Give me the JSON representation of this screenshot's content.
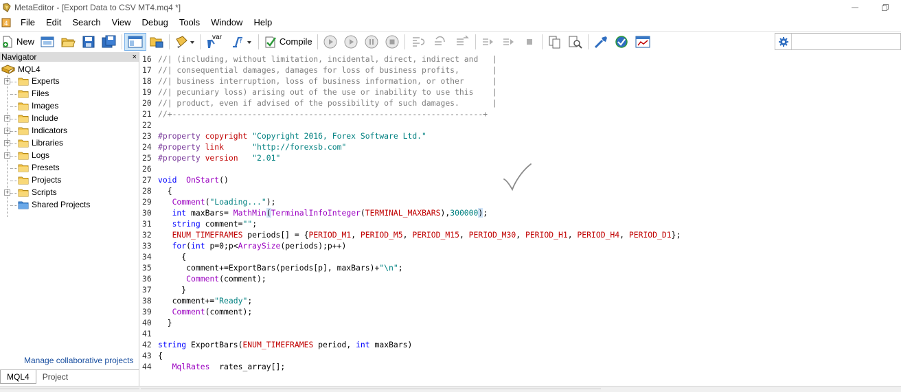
{
  "window": {
    "title": "MetaEditor - [Export Data to CSV MT4.mq4 *]"
  },
  "menu": {
    "items": [
      "File",
      "Edit",
      "Search",
      "View",
      "Debug",
      "Tools",
      "Window",
      "Help"
    ]
  },
  "toolbar": {
    "new_label": "New",
    "var_label": "var",
    "compile_label": "Compile",
    "search_placeholder": ""
  },
  "navigator": {
    "title": "Navigator",
    "close_glyph": "×",
    "root": "MQL4",
    "items": [
      {
        "label": "Experts",
        "expandable": true
      },
      {
        "label": "Files",
        "expandable": false
      },
      {
        "label": "Images",
        "expandable": false
      },
      {
        "label": "Include",
        "expandable": true
      },
      {
        "label": "Indicators",
        "expandable": true
      },
      {
        "label": "Libraries",
        "expandable": true
      },
      {
        "label": "Logs",
        "expandable": true
      },
      {
        "label": "Presets",
        "expandable": false
      },
      {
        "label": "Projects",
        "expandable": false
      },
      {
        "label": "Scripts",
        "expandable": true
      },
      {
        "label": "Shared Projects",
        "expandable": false
      }
    ],
    "manage_link": "Manage collaborative projects",
    "tabs": [
      "MQL4",
      "Project"
    ]
  },
  "editor": {
    "lines": [
      {
        "n": "16",
        "tokens": [
          [
            "comment",
            "//| (including, without limitation, incidental, direct, indirect and   |"
          ]
        ]
      },
      {
        "n": "17",
        "tokens": [
          [
            "comment",
            "//| consequential damages, damages for loss of business profits,       |"
          ]
        ]
      },
      {
        "n": "18",
        "tokens": [
          [
            "comment",
            "//| business interruption, loss of business information, or other      |"
          ]
        ]
      },
      {
        "n": "19",
        "tokens": [
          [
            "comment",
            "//| pecuniary loss) arising out of the use or inability to use this    |"
          ]
        ]
      },
      {
        "n": "20",
        "tokens": [
          [
            "comment",
            "//| product, even if advised of the possibility of such damages.       |"
          ]
        ]
      },
      {
        "n": "21",
        "tokens": [
          [
            "comment",
            "//+------------------------------------------------------------------+"
          ]
        ]
      },
      {
        "n": "22",
        "tokens": []
      },
      {
        "n": "23",
        "tokens": [
          [
            "property",
            "#property "
          ],
          [
            "propname",
            "copyright "
          ],
          [
            "string",
            "\"Copyright 2016, Forex Software Ltd.\""
          ]
        ]
      },
      {
        "n": "24",
        "tokens": [
          [
            "property",
            "#property "
          ],
          [
            "propname",
            "link      "
          ],
          [
            "string",
            "\"http://forexsb.com\""
          ]
        ]
      },
      {
        "n": "25",
        "tokens": [
          [
            "property",
            "#property "
          ],
          [
            "propname",
            "version   "
          ],
          [
            "string",
            "\"2.01\""
          ]
        ]
      },
      {
        "n": "26",
        "tokens": []
      },
      {
        "n": "27",
        "tokens": [
          [
            "keyword",
            "void"
          ],
          [
            "text",
            "  "
          ],
          [
            "func",
            "OnStart"
          ],
          [
            "text",
            "()"
          ]
        ]
      },
      {
        "n": "28",
        "tokens": [
          [
            "text",
            "  {"
          ]
        ]
      },
      {
        "n": "29",
        "tokens": [
          [
            "text",
            "   "
          ],
          [
            "func",
            "Comment"
          ],
          [
            "text",
            "("
          ],
          [
            "string",
            "\"Loading...\""
          ],
          [
            "text",
            ");"
          ]
        ]
      },
      {
        "n": "30",
        "tokens": [
          [
            "text",
            "   "
          ],
          [
            "keyword",
            "int"
          ],
          [
            "text",
            " maxBars= "
          ],
          [
            "func",
            "MathMin"
          ],
          [
            "mark",
            "("
          ],
          [
            "func",
            "TerminalInfoInteger"
          ],
          [
            "text",
            "("
          ],
          [
            "enum",
            "TERMINAL_MAXBARS"
          ],
          [
            "text",
            "),"
          ],
          [
            "string",
            "300000"
          ],
          [
            "mark",
            ")"
          ],
          [
            "text",
            ";"
          ]
        ]
      },
      {
        "n": "31",
        "tokens": [
          [
            "text",
            "   "
          ],
          [
            "keyword",
            "string"
          ],
          [
            "text",
            " comment="
          ],
          [
            "string",
            "\"\""
          ],
          [
            "text",
            ";"
          ]
        ]
      },
      {
        "n": "32",
        "tokens": [
          [
            "text",
            "   "
          ],
          [
            "enum",
            "ENUM_TIMEFRAMES"
          ],
          [
            "text",
            " periods[] = {"
          ],
          [
            "enum",
            "PERIOD_M1"
          ],
          [
            "text",
            ", "
          ],
          [
            "enum",
            "PERIOD_M5"
          ],
          [
            "text",
            ", "
          ],
          [
            "enum",
            "PERIOD_M15"
          ],
          [
            "text",
            ", "
          ],
          [
            "enum",
            "PERIOD_M30"
          ],
          [
            "text",
            ", "
          ],
          [
            "enum",
            "PERIOD_H1"
          ],
          [
            "text",
            ", "
          ],
          [
            "enum",
            "PERIOD_H4"
          ],
          [
            "text",
            ", "
          ],
          [
            "enum",
            "PERIOD_D1"
          ],
          [
            "text",
            "};"
          ]
        ]
      },
      {
        "n": "33",
        "tokens": [
          [
            "text",
            "   "
          ],
          [
            "keyword",
            "for"
          ],
          [
            "text",
            "("
          ],
          [
            "keyword",
            "int"
          ],
          [
            "text",
            " p=0;p<"
          ],
          [
            "func",
            "ArraySize"
          ],
          [
            "text",
            "(periods);p++)"
          ]
        ]
      },
      {
        "n": "34",
        "tokens": [
          [
            "text",
            "     {"
          ]
        ]
      },
      {
        "n": "35",
        "tokens": [
          [
            "text",
            "      comment+=ExportBars(periods[p], maxBars)+"
          ],
          [
            "string",
            "\"\\n\""
          ],
          [
            "text",
            ";"
          ]
        ]
      },
      {
        "n": "36",
        "tokens": [
          [
            "text",
            "      "
          ],
          [
            "func",
            "Comment"
          ],
          [
            "text",
            "(comment);"
          ]
        ]
      },
      {
        "n": "37",
        "tokens": [
          [
            "text",
            "     }"
          ]
        ]
      },
      {
        "n": "38",
        "tokens": [
          [
            "text",
            "   comment+="
          ],
          [
            "string",
            "\"Ready\""
          ],
          [
            "text",
            ";"
          ]
        ]
      },
      {
        "n": "39",
        "tokens": [
          [
            "text",
            "   "
          ],
          [
            "func",
            "Comment"
          ],
          [
            "text",
            "(comment);"
          ]
        ]
      },
      {
        "n": "40",
        "tokens": [
          [
            "text",
            "  }"
          ]
        ]
      },
      {
        "n": "41",
        "tokens": []
      },
      {
        "n": "42",
        "tokens": [
          [
            "keyword",
            "string"
          ],
          [
            "text",
            " ExportBars("
          ],
          [
            "enum",
            "ENUM_TIMEFRAMES"
          ],
          [
            "text",
            " period, "
          ],
          [
            "keyword",
            "int"
          ],
          [
            "text",
            " maxBars)"
          ]
        ]
      },
      {
        "n": "43",
        "tokens": [
          [
            "text",
            "{"
          ]
        ]
      },
      {
        "n": "44",
        "tokens": [
          [
            "text",
            "   "
          ],
          [
            "func",
            "MqlRates"
          ],
          [
            "text",
            "  rates_array[];"
          ]
        ]
      }
    ]
  },
  "colors": {
    "comment": "#808080",
    "keyword": "#0000ff",
    "property": "#7a3b9b",
    "propname": "#c00000",
    "string": "#008080",
    "func": "#9a00c0",
    "enum": "#c00000"
  }
}
